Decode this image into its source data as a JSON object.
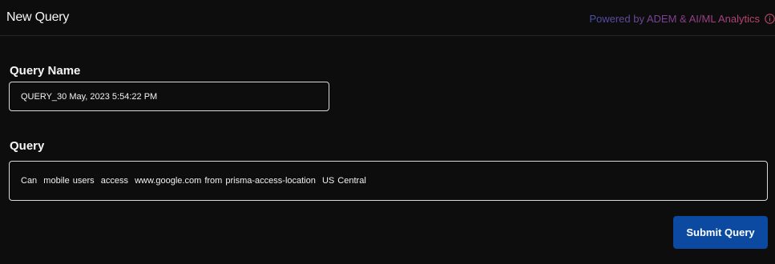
{
  "header": {
    "title": "New Query",
    "powered_by": "Powered by ADEM & AI/ML Analytics",
    "info_icon": "info-icon"
  },
  "form": {
    "query_name_label": "Query Name",
    "query_name_value": "QUERY_30 May, 2023 5:54:22 PM",
    "query_label": "Query",
    "query_value": "Can  mobile users  access  www.google.com from prisma-access-location  US Central",
    "submit_label": "Submit Query"
  },
  "colors": {
    "background": "#0d0d0d",
    "submit_button": "#0b4aa0",
    "powered_gradient_start": "#4b4faa",
    "powered_gradient_end": "#c2456a",
    "info_icon": "#c2456a"
  }
}
